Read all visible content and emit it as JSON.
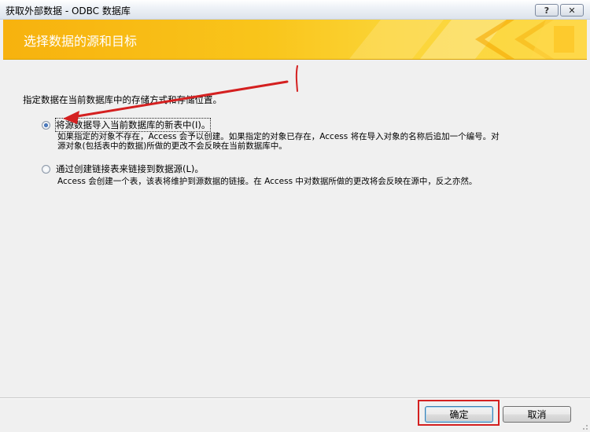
{
  "window": {
    "title": "获取外部数据 - ODBC 数据库",
    "help_label": "?",
    "close_label": "✕"
  },
  "banner": {
    "title": "选择数据的源和目标"
  },
  "instruction": "指定数据在当前数据库中的存储方式和存储位置。",
  "options": [
    {
      "label": "将源数据导入当前数据库的新表中(I)。",
      "selected": true,
      "description_line1": "如果指定的对象不存在，Access 会予以创建。如果指定的对象已存在，Access 将在导入对象的名称后追加一个编号。对",
      "description_line2": "源对象(包括表中的数据)所做的更改不会反映在当前数据库中。"
    },
    {
      "label": "通过创建链接表来链接到数据源(L)。",
      "selected": false,
      "description_line1": "Access 会创建一个表，该表将维护到源数据的链接。在 Access 中对数据所做的更改将会反映在源中，反之亦然。"
    }
  ],
  "footer": {
    "ok_label": "确定",
    "cancel_label": "取消"
  },
  "colors": {
    "banner_accent": "#f9c51b",
    "annotation_red": "#d42020"
  }
}
